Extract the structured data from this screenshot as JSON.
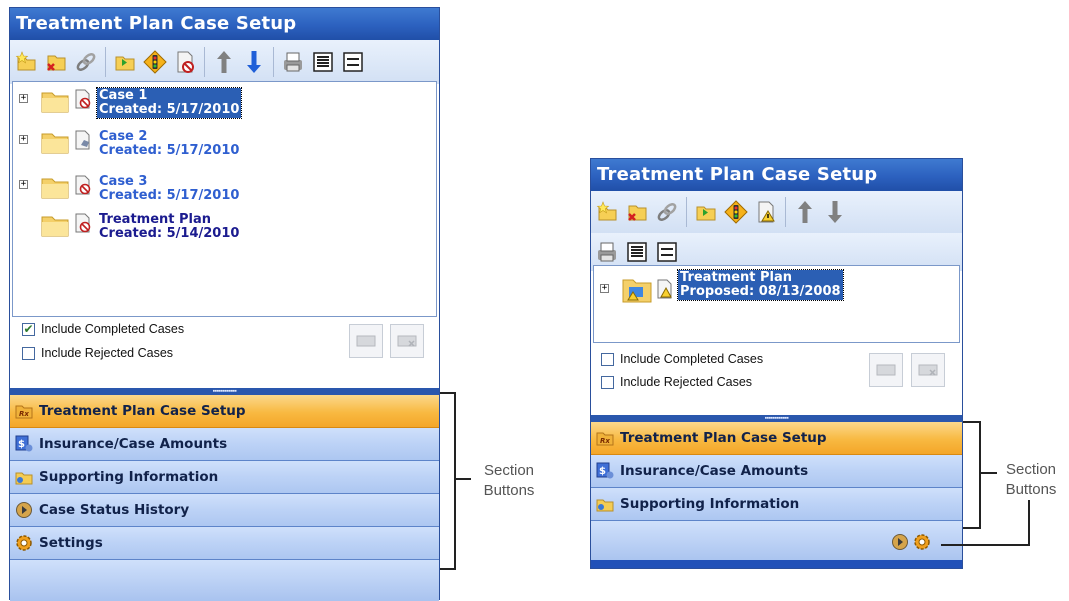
{
  "left_panel": {
    "title": "Treatment Plan Case Setup",
    "tree": [
      {
        "line1": "Case 1",
        "line2": "Created: 5/17/2010"
      },
      {
        "line1": "Case 2",
        "line2": "Created: 5/17/2010"
      },
      {
        "line1": "Case 3",
        "line2": "Created: 5/17/2010"
      },
      {
        "line1": "Treatment Plan",
        "line2": "Created: 5/14/2010"
      }
    ],
    "include_completed": {
      "label": "Include Completed Cases",
      "checked": true
    },
    "include_rejected": {
      "label": "Include Rejected Cases",
      "checked": false
    },
    "sections": [
      {
        "label": "Treatment Plan Case Setup",
        "icon": "treatment-plan-icon"
      },
      {
        "label": "Insurance/Case Amounts",
        "icon": "insurance-icon"
      },
      {
        "label": "Supporting Information",
        "icon": "folder-icon"
      },
      {
        "label": "Case Status History",
        "icon": "history-icon"
      },
      {
        "label": "Settings",
        "icon": "gear-icon"
      }
    ]
  },
  "right_panel": {
    "title": "Treatment Plan Case Setup",
    "tree": [
      {
        "line1": "Treatment Plan",
        "line2": "Proposed: 08/13/2008"
      }
    ],
    "include_completed": {
      "label": "Include Completed Cases",
      "checked": false
    },
    "include_rejected": {
      "label": "Include Rejected Cases",
      "checked": false
    },
    "sections": [
      {
        "label": "Treatment Plan Case Setup",
        "icon": "treatment-plan-icon"
      },
      {
        "label": "Insurance/Case Amounts",
        "icon": "insurance-icon"
      },
      {
        "label": "Supporting Information",
        "icon": "folder-icon"
      }
    ]
  },
  "callouts": {
    "left": "Section\nButtons",
    "right": "Section\nButtons"
  },
  "colors": {
    "title_bar": "#2c61bf",
    "section_active": "#f8b941",
    "section_inactive": "#bcd2f6",
    "link_text": "#2f5fd0",
    "selection": "#2b5fb4"
  }
}
